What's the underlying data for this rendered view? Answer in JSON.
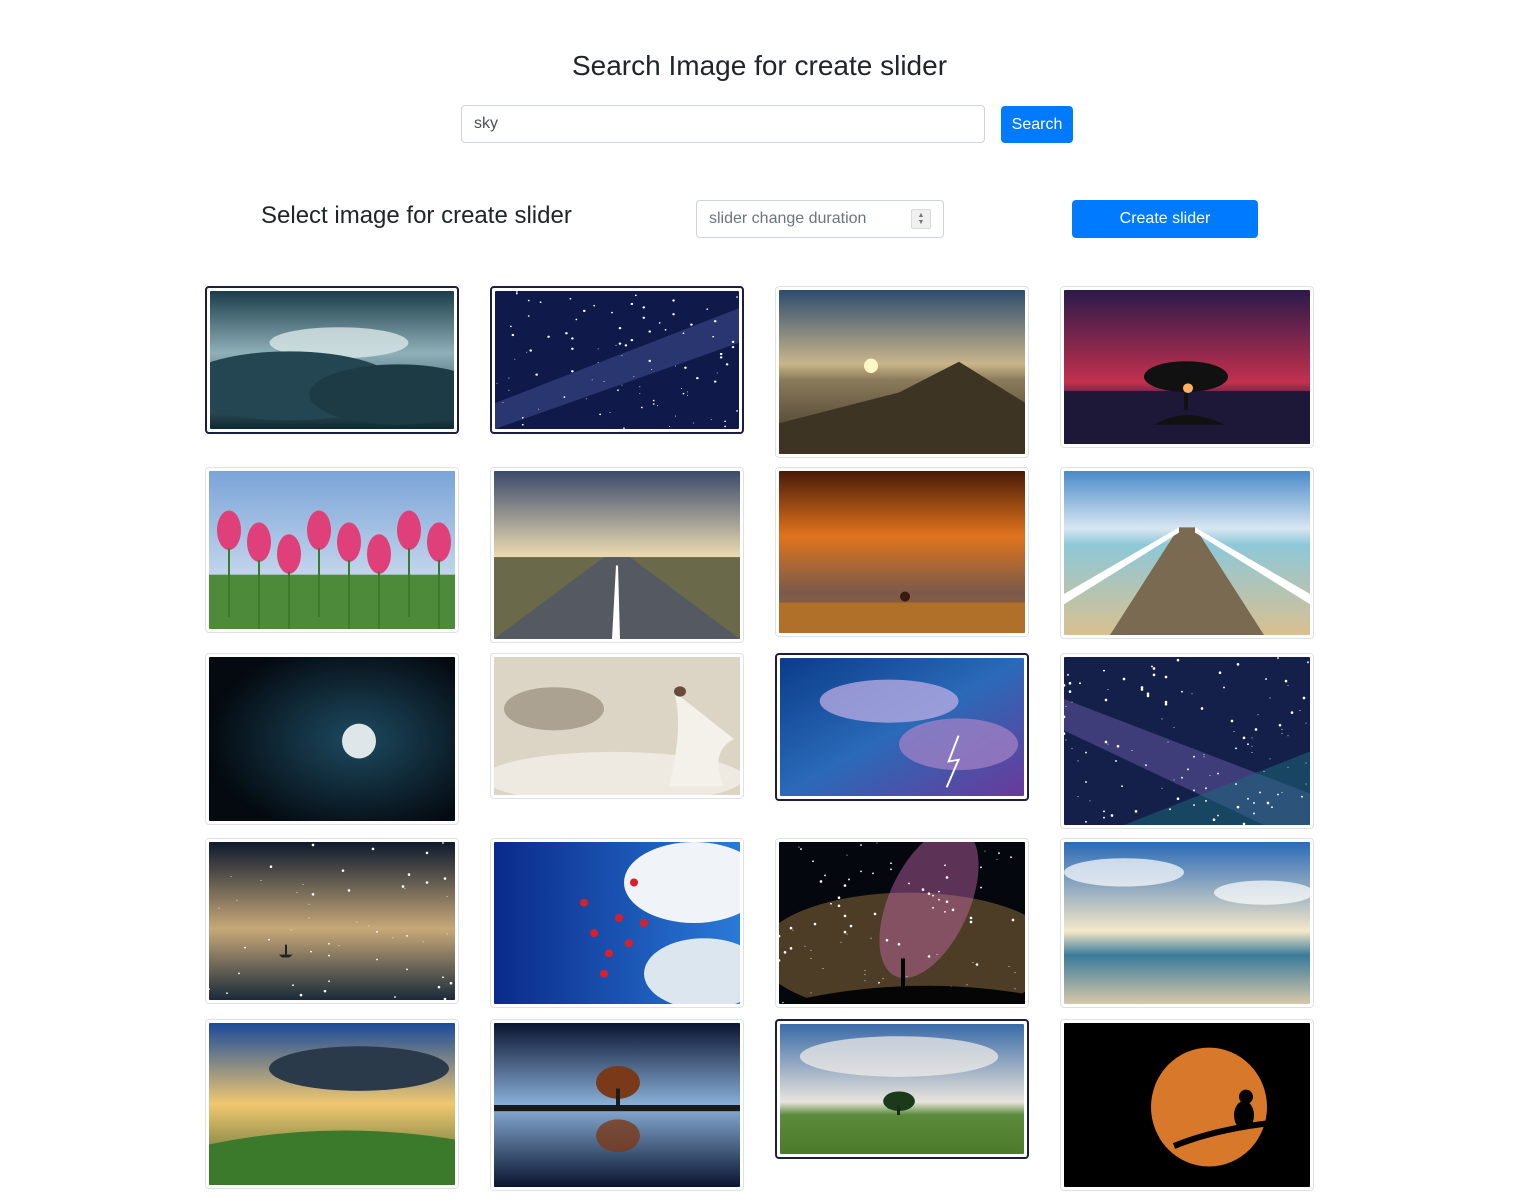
{
  "page": {
    "title": "Search Image for create slider",
    "search": {
      "value": "sky",
      "button_label": "Search"
    },
    "select_heading": "Select image for create slider",
    "duration": {
      "placeholder": "slider change duration"
    },
    "create_button_label": "Create slider"
  },
  "images": [
    {
      "name": "image-cloudy-sky-dark",
      "selected": true
    },
    {
      "name": "image-milky-way-stars",
      "selected": true
    },
    {
      "name": "image-sunset-over-mountain",
      "selected": false
    },
    {
      "name": "image-red-sky-tree-silhouette",
      "selected": false
    },
    {
      "name": "image-pink-tulips",
      "selected": false
    },
    {
      "name": "image-road-under-clouds",
      "selected": false
    },
    {
      "name": "image-orange-clouds-tree",
      "selected": false
    },
    {
      "name": "image-white-pier-sea",
      "selected": false
    },
    {
      "name": "image-full-moon-night",
      "selected": false
    },
    {
      "name": "image-woman-in-clouds",
      "selected": false
    },
    {
      "name": "image-lightning-storm",
      "selected": true
    },
    {
      "name": "image-galaxy-stars",
      "selected": false
    },
    {
      "name": "image-night-sea-reflection",
      "selected": false
    },
    {
      "name": "image-heart-balloons-sky",
      "selected": false
    },
    {
      "name": "image-colorful-milky-way-silhouette",
      "selected": false
    },
    {
      "name": "image-beach-with-birds",
      "selected": false
    },
    {
      "name": "image-sun-rays-over-hills",
      "selected": false
    },
    {
      "name": "image-tree-reflection-night",
      "selected": false
    },
    {
      "name": "image-tree-in-meadow-clouds",
      "selected": true
    },
    {
      "name": "image-cat-on-branch-moon",
      "selected": false
    }
  ]
}
